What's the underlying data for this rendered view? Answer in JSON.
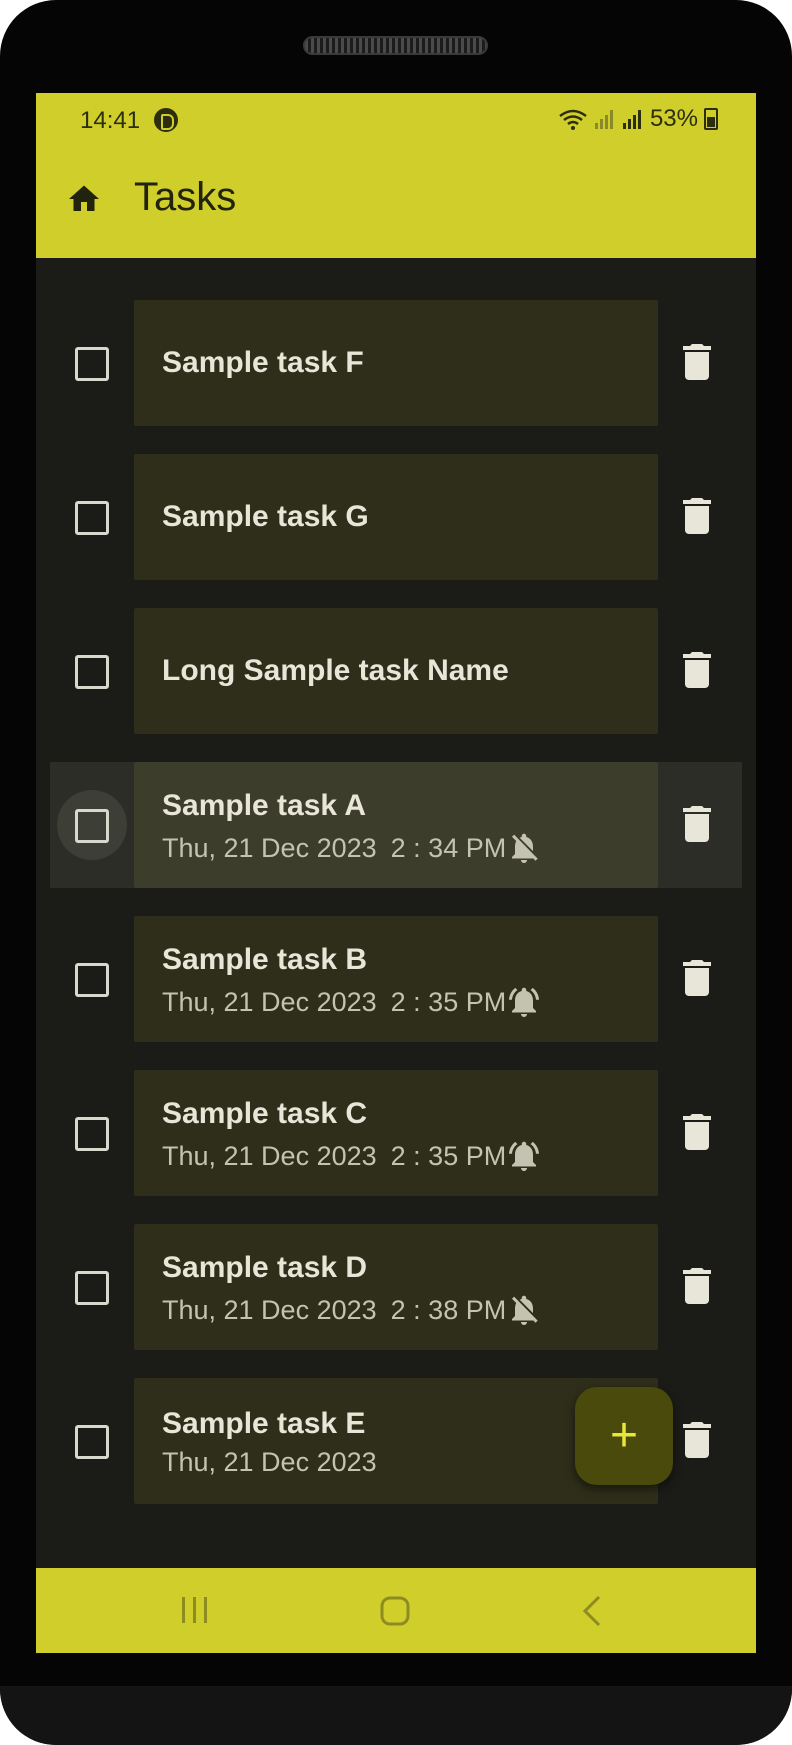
{
  "status_bar": {
    "time": "14:41",
    "battery_percent": "53%"
  },
  "app_bar": {
    "title": "Tasks"
  },
  "tasks": [
    {
      "title": "Sample task F",
      "date": "",
      "time": "",
      "alarm": "none",
      "checked": false
    },
    {
      "title": "Sample task G",
      "date": "",
      "time": "",
      "alarm": "none",
      "checked": false
    },
    {
      "title": "Long Sample task Name",
      "date": "",
      "time": "",
      "alarm": "none",
      "checked": false
    },
    {
      "title": "Sample task A",
      "date": "Thu, 21 Dec 2023",
      "time": "2 : 34 PM",
      "alarm": "off",
      "checked": false,
      "selected": true
    },
    {
      "title": "Sample task B",
      "date": "Thu, 21 Dec 2023",
      "time": "2 : 35 PM",
      "alarm": "on",
      "checked": false
    },
    {
      "title": "Sample task C",
      "date": "Thu, 21 Dec 2023",
      "time": "2 : 35 PM",
      "alarm": "on",
      "checked": false
    },
    {
      "title": "Sample task D",
      "date": "Thu, 21 Dec 2023",
      "time": "2 : 38 PM",
      "alarm": "off",
      "checked": false
    },
    {
      "title": "Sample task E",
      "date": "Thu, 21 Dec 2023",
      "time": "",
      "alarm": "none",
      "checked": false
    }
  ],
  "fab": {
    "label": "+"
  },
  "icons": {
    "home": "home-icon",
    "trash": "trash-icon",
    "alarm_on": "bell-ringing-icon",
    "alarm_off": "bell-off-icon",
    "checkbox": "checkbox-icon",
    "nav_recents": "recents-icon",
    "nav_home": "nav-home-icon",
    "nav_back": "back-icon"
  },
  "colors": {
    "accent": "#cfce2a",
    "background": "#1b1c18",
    "card": "#2e2e1a",
    "card_selected": "#3d3d2b",
    "fab": "#4a4a0c",
    "fab_icon": "#e8e63a",
    "text_primary": "#e8e6d8",
    "text_secondary": "#c4c2b1"
  }
}
